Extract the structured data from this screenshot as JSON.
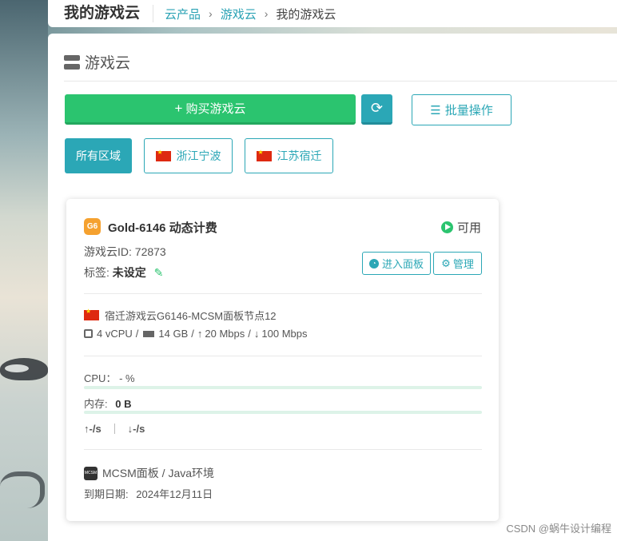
{
  "topbar": {
    "title": "我的游戏云",
    "breadcrumb": [
      "云产品",
      "游戏云",
      "我的游戏云"
    ]
  },
  "panel": {
    "title": "游戏云"
  },
  "toolbar": {
    "buy_label": "购买游戏云",
    "refresh_icon": "refresh-icon",
    "batch_label": "批量操作"
  },
  "regions": [
    {
      "label": "所有区域",
      "active": true
    },
    {
      "label": "浙江宁波",
      "flag": "cn-flag"
    },
    {
      "label": "江苏宿迁",
      "flag": "cn-flag"
    }
  ],
  "card": {
    "badge": "G6",
    "name": "Gold-6146 动态计费",
    "status": "可用",
    "id_label": "游戏云ID: 72873",
    "tag_prefix": "标签:",
    "tag_value": "未设定",
    "enter_panel_label": "进入面板",
    "manage_label": "管理",
    "node": "宿迁游戏云G6146-MCSM面板节点12",
    "specs": {
      "cpu": "4 vCPU",
      "ram": "14 GB",
      "up": "20 Mbps",
      "down": "100 Mbps"
    },
    "cpu_label": "CPU：",
    "cpu_value": "- %",
    "cpu_usage": 0,
    "mem_label": "内存:",
    "mem_value": "0 B",
    "mem_usage": 0,
    "net_up": "-/s",
    "net_down": "-/s",
    "panel_type": "MCSM面板 / Java环境",
    "expire_label": "到期日期:",
    "expire_value": "2024年12月11日",
    "mcsm_logo": "MCSM"
  },
  "watermark": "CSDN @蜗牛设计编程",
  "colors": {
    "accent": "#2ba7b6",
    "green": "#2bc46f",
    "badge": "#f5a12f"
  }
}
